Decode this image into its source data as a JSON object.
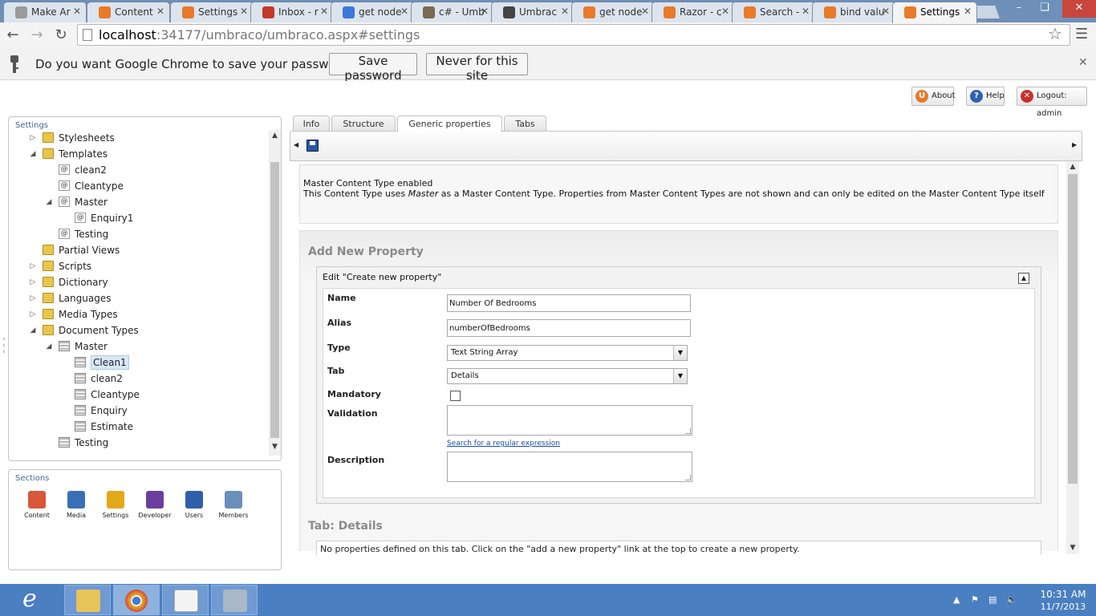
{
  "browser": {
    "tabs": [
      {
        "title": "Make Ar",
        "fav_color": "#9a9a9a",
        "active": false
      },
      {
        "title": "Content",
        "fav_color": "#e87a2a",
        "active": false
      },
      {
        "title": "Settings",
        "fav_color": "#e87a2a",
        "active": false
      },
      {
        "title": "Inbox - r",
        "fav_color": "#c33a2b",
        "active": false
      },
      {
        "title": "get node",
        "fav_color": "#3b77db",
        "active": false
      },
      {
        "title": "c# - Umb",
        "fav_color": "#7a6a52",
        "active": false
      },
      {
        "title": "Umbrac",
        "fav_color": "#444444",
        "active": false
      },
      {
        "title": "get node",
        "fav_color": "#e87a2a",
        "active": false
      },
      {
        "title": "Razor - c",
        "fav_color": "#e87a2a",
        "active": false
      },
      {
        "title": "Search -",
        "fav_color": "#e87a2a",
        "active": false
      },
      {
        "title": "bind valu",
        "fav_color": "#e87a2a",
        "active": false
      },
      {
        "title": "Settings",
        "fav_color": "#e87a2a",
        "active": true
      }
    ],
    "url_host": "localhost",
    "url_rest": ":34177/umbraco/umbraco.aspx#settings",
    "password_bar": {
      "question": "Do you want Google Chrome to save your password?",
      "save_label": "Save password",
      "never_label": "Never for this site"
    }
  },
  "umbraco": {
    "top_buttons": {
      "about": "About",
      "help": "Help",
      "logout": "Logout: admin"
    },
    "tree_panel_title": "Settings",
    "tree": [
      {
        "label": "Stylesheets",
        "level": 0,
        "icon": "folder",
        "arrow": "▷"
      },
      {
        "label": "Templates",
        "level": 0,
        "icon": "folder",
        "arrow": "◢"
      },
      {
        "label": "clean2",
        "level": 1,
        "icon": "template",
        "arrow": ""
      },
      {
        "label": "Cleantype",
        "level": 1,
        "icon": "template",
        "arrow": ""
      },
      {
        "label": "Master",
        "level": 1,
        "icon": "template",
        "arrow": "◢"
      },
      {
        "label": "Enquiry1",
        "level": 2,
        "icon": "template",
        "arrow": ""
      },
      {
        "label": "Testing",
        "level": 1,
        "icon": "template",
        "arrow": ""
      },
      {
        "label": "Partial Views",
        "level": 0,
        "icon": "folder",
        "arrow": ""
      },
      {
        "label": "Scripts",
        "level": 0,
        "icon": "folder",
        "arrow": "▷"
      },
      {
        "label": "Dictionary",
        "level": 0,
        "icon": "folder",
        "arrow": "▷"
      },
      {
        "label": "Languages",
        "level": 0,
        "icon": "folder",
        "arrow": "▷"
      },
      {
        "label": "Media Types",
        "level": 0,
        "icon": "folder",
        "arrow": "▷"
      },
      {
        "label": "Document Types",
        "level": 0,
        "icon": "folder",
        "arrow": "◢"
      },
      {
        "label": "Master",
        "level": 1,
        "icon": "doctype",
        "arrow": "◢"
      },
      {
        "label": "Clean1",
        "level": 2,
        "icon": "doctype",
        "arrow": "",
        "selected": true
      },
      {
        "label": "clean2",
        "level": 2,
        "icon": "doctype",
        "arrow": ""
      },
      {
        "label": "Cleantype",
        "level": 2,
        "icon": "doctype",
        "arrow": ""
      },
      {
        "label": "Enquiry",
        "level": 2,
        "icon": "doctype",
        "arrow": ""
      },
      {
        "label": "Estimate",
        "level": 2,
        "icon": "doctype",
        "arrow": ""
      },
      {
        "label": "Testing",
        "level": 1,
        "icon": "doctype",
        "arrow": ""
      }
    ],
    "sections_title": "Sections",
    "sections": [
      {
        "label": "Content",
        "color": "#d9573a"
      },
      {
        "label": "Media",
        "color": "#3a6fb5"
      },
      {
        "label": "Settings",
        "color": "#e2a91a"
      },
      {
        "label": "Developer",
        "color": "#6b3fa0"
      },
      {
        "label": "Users",
        "color": "#2f5fa8"
      },
      {
        "label": "Members",
        "color": "#6a8fb8"
      }
    ],
    "tabs": [
      {
        "label": "Info",
        "active": false
      },
      {
        "label": "Structure",
        "active": false
      },
      {
        "label": "Generic properties",
        "active": true
      },
      {
        "label": "Tabs",
        "active": false
      }
    ],
    "master_box": {
      "title": "Master Content Type enabled",
      "text_before": "This Content Type uses ",
      "text_italic": "Master",
      "text_after": " as a Master Content Type. Properties from Master Content Types are not shown and can only be edited on the Master Content Type itself"
    },
    "add_property": {
      "heading": "Add New Property",
      "edit_title": "Edit \"Create new property\"",
      "fields": {
        "name_label": "Name",
        "name_value": "Number Of Bedrooms",
        "alias_label": "Alias",
        "alias_value": "numberOfBedrooms",
        "type_label": "Type",
        "type_value": "Text String Array",
        "tab_label": "Tab",
        "tab_value": "Details",
        "mandatory_label": "Mandatory",
        "validation_label": "Validation",
        "regex_link": "Search for a regular expression",
        "description_label": "Description"
      }
    },
    "tab_details": {
      "heading": "Tab: Details",
      "text": "No properties defined on this tab. Click on the \"add a new property\" link at the top to create a new property."
    }
  },
  "taskbar": {
    "time": "10:31 AM",
    "date": "11/7/2013"
  }
}
